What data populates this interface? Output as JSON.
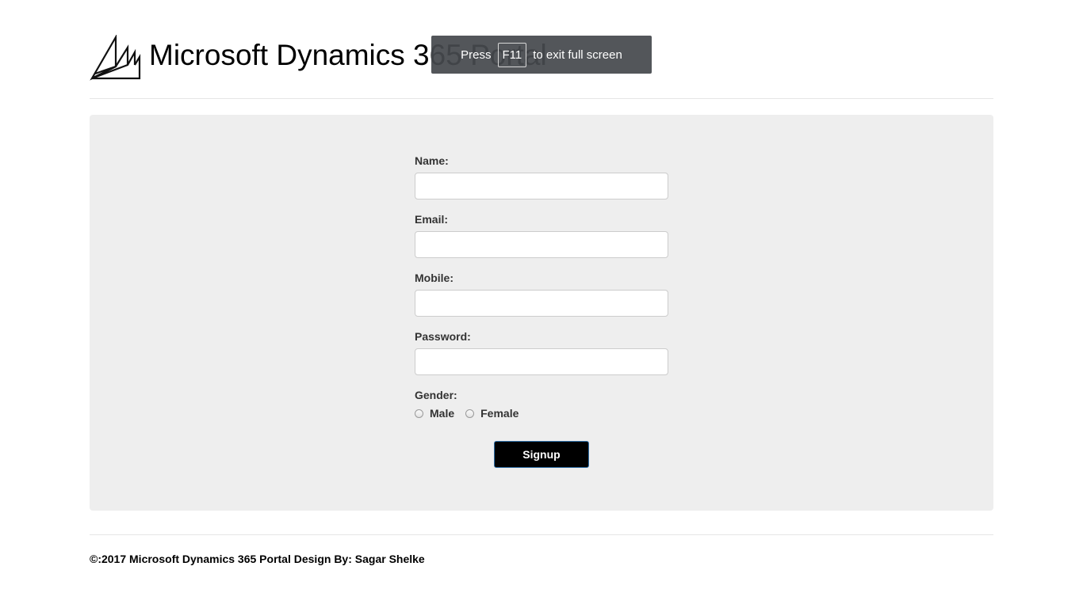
{
  "header": {
    "title": "Microsoft Dynamics 365 Portal",
    "logo_icon": "microsoft-dynamics-logo"
  },
  "fullscreen_notice": {
    "prefix": "Press",
    "key": "F11",
    "suffix": "to exit full screen"
  },
  "form": {
    "fields": [
      {
        "label": "Name:",
        "value": "",
        "placeholder": ""
      },
      {
        "label": "Email:",
        "value": "",
        "placeholder": ""
      },
      {
        "label": "Mobile:",
        "value": "",
        "placeholder": ""
      },
      {
        "label": "Password:",
        "value": "",
        "placeholder": ""
      }
    ],
    "gender": {
      "label": "Gender:",
      "options": [
        "Male",
        "Female"
      ]
    },
    "submit_label": "Signup"
  },
  "footer": {
    "text": "©:2017 Microsoft Dynamics 365 Portal Design By: Sagar Shelke"
  },
  "colors": {
    "panel_background": "#eeeeee",
    "button_background": "#000000",
    "button_border": "#2e6da4",
    "toast_background": "#46494e"
  }
}
